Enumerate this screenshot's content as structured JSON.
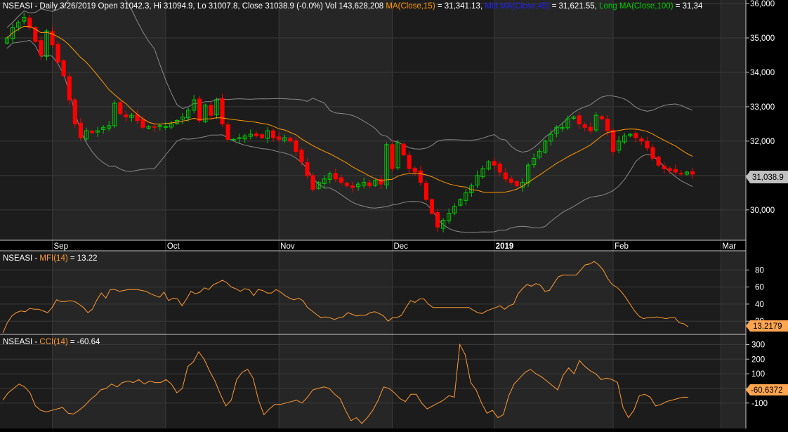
{
  "colors": {
    "background": "#1c1c1c",
    "band_shade": "#262626",
    "grid": "#3a3a3a",
    "separator": "#c8c8c8",
    "axis_text": "#ffffff",
    "candle_up": "#00cc00",
    "candle_down": "#ff0000",
    "ma_short": "#ff9900",
    "ma_mid": "#0000ff",
    "ma_long": "#00cc00",
    "bollinger": "#8a8a8a",
    "indicator_line": "#ff9933",
    "badge_price": "#c0c0c0",
    "badge_indicator": "#ffa54f"
  },
  "price_panel": {
    "header": {
      "symbol": "NSEASI",
      "info": " - Daily 3/26/2019 Open 31042.3, Hi 31094.9, Lo 31007.8, Close 31038.9 (-0.0%) Vol 143,628,208 ",
      "ma_short": "MA(Close,15)",
      "ma_short_value": " = 31,341.13, ",
      "ma_mid": "Mid MA(Close,45)",
      "ma_mid_value": " = 31,621.55, ",
      "ma_long": "Long MA(Close,100)",
      "ma_long_value": " = 31,34"
    },
    "last_value_badge": "31,038.9"
  },
  "mfi_panel": {
    "header": {
      "symbol": "NSEASI",
      "dash": " - ",
      "label": "MFI(14)",
      "value": " = 13.22"
    },
    "last_value_badge": "13.2179"
  },
  "cci_panel": {
    "header": {
      "symbol": "NSEASI",
      "dash": " - ",
      "label": "CCI(14)",
      "value": " = -60.64"
    },
    "last_value_badge": "-60.6372"
  },
  "chart_data": [
    {
      "type": "candlestick",
      "ylim": [
        29200,
        36000
      ],
      "y_ticks": [
        30000,
        31000,
        32000,
        33000,
        34000,
        35000,
        36000
      ],
      "y_tick_labels": [
        "30,000",
        "31,000",
        "32,000",
        "33,000",
        "34,000",
        "35,000",
        "36,000"
      ],
      "x_axis_labels": [
        {
          "label": "Sep",
          "index": 8,
          "bold": false
        },
        {
          "label": "Oct",
          "index": 28,
          "bold": false
        },
        {
          "label": "Nov",
          "index": 48,
          "bold": false
        },
        {
          "label": "Dec",
          "index": 68,
          "bold": false
        },
        {
          "label": "2019",
          "index": 86,
          "bold": true
        },
        {
          "label": "Feb",
          "index": 107,
          "bold": false
        },
        {
          "label": "Mar",
          "index": 126,
          "bold": false
        }
      ],
      "grid": true,
      "close": [
        35000,
        35300,
        35450,
        35600,
        35300,
        34900,
        34500,
        35200,
        34800,
        34300,
        33900,
        33200,
        32500,
        32100,
        32300,
        32250,
        32300,
        32400,
        32450,
        33100,
        32800,
        32700,
        32750,
        32600,
        32400,
        32420,
        32400,
        32450,
        32420,
        32500,
        32600,
        32700,
        32900,
        33200,
        32600,
        33050,
        32750,
        33200,
        32500,
        32050,
        32050,
        32100,
        32150,
        32200,
        32150,
        32100,
        32300,
        32100,
        32050,
        32100,
        32000,
        31700,
        31400,
        31000,
        30600,
        30800,
        30900,
        31050,
        30900,
        30800,
        30700,
        30650,
        30750,
        30800,
        30700,
        30850,
        30750,
        31900,
        31200,
        31950,
        31600,
        31200,
        31100,
        30800,
        30300,
        29900,
        29500,
        29700,
        29900,
        30100,
        30300,
        30500,
        30700,
        31000,
        31200,
        31400,
        31300,
        31100,
        30900,
        30800,
        30700,
        30800,
        31300,
        31500,
        31700,
        32000,
        32200,
        32400,
        32400,
        32650,
        32700,
        32500,
        32400,
        32300,
        32750,
        32650,
        32300,
        31700,
        32000,
        32150,
        32200,
        32100,
        32000,
        31800,
        31500,
        31300,
        31200,
        31150,
        31100,
        31050,
        31100,
        31040
      ],
      "source": "close series; open/high/low reconstructed by script for candles"
    },
    {
      "type": "line",
      "name_printed": "MFI(14)",
      "ylim": [
        7,
        100
      ],
      "y_ticks": [
        20,
        40,
        60,
        80
      ],
      "values": [
        6,
        18,
        26,
        30,
        32,
        31,
        35,
        34,
        34,
        32,
        30,
        36,
        45,
        43,
        43,
        44,
        43,
        40,
        36,
        30,
        34,
        45,
        53,
        47,
        57,
        57,
        55,
        56,
        57,
        57,
        57,
        56,
        55,
        52,
        50,
        48,
        54,
        44,
        47,
        46,
        38,
        46,
        55,
        52,
        54,
        59,
        57,
        63,
        65,
        68,
        65,
        60,
        58,
        55,
        58,
        57,
        50,
        57,
        56,
        53,
        53,
        57,
        54,
        50,
        47,
        45,
        47,
        44,
        36,
        32,
        28,
        24,
        25,
        24,
        22,
        24,
        25,
        30,
        28,
        26,
        27,
        27,
        30,
        31,
        29,
        26,
        20,
        24,
        24,
        27,
        36,
        44,
        42,
        46,
        46,
        40,
        36,
        36,
        36,
        36,
        36,
        36,
        36,
        36,
        36,
        33,
        30,
        29,
        32,
        34,
        36,
        38,
        34,
        38,
        40,
        52,
        58,
        63,
        61,
        64,
        62,
        55,
        56,
        64,
        72,
        74,
        74,
        74,
        74,
        80,
        86,
        87,
        90,
        86,
        80,
        70,
        63,
        60,
        55,
        48,
        40,
        32,
        26,
        23,
        24,
        24,
        25,
        24,
        23,
        24,
        24,
        18,
        17,
        13.22
      ]
    },
    {
      "type": "line",
      "name_printed": "CCI(14)",
      "ylim": [
        -250,
        350
      ],
      "y_ticks": [
        -100,
        0,
        100,
        200,
        300
      ],
      "y_tick_labels": [
        "-100",
        "0",
        "100",
        "200",
        "300"
      ],
      "values": [
        -80,
        -30,
        0,
        30,
        10,
        -30,
        -120,
        -150,
        -160,
        -150,
        -140,
        -130,
        -170,
        -175,
        -150,
        -120,
        -80,
        -50,
        -10,
        0,
        30,
        10,
        40,
        50,
        40,
        60,
        30,
        50,
        40,
        40,
        60,
        30,
        -30,
        0,
        150,
        180,
        250,
        200,
        120,
        50,
        -40,
        -120,
        -80,
        60,
        110,
        130,
        70,
        -80,
        -180,
        -140,
        -110,
        -110,
        -100,
        -90,
        -80,
        -100,
        -60,
        -10,
        0,
        10,
        0,
        -40,
        -70,
        -150,
        -220,
        -200,
        -240,
        -200,
        -150,
        -80,
        10,
        0,
        -30,
        -70,
        -90,
        -40,
        -40,
        -100,
        -140,
        -120,
        -100,
        -80,
        -50,
        -60,
        300,
        230,
        40,
        -10,
        -100,
        -170,
        -150,
        -200,
        -180,
        -50,
        30,
        70,
        110,
        130,
        100,
        80,
        50,
        20,
        -10,
        90,
        140,
        100,
        190,
        150,
        120,
        100,
        60,
        70,
        60,
        40,
        -130,
        -200,
        -150,
        -50,
        -40,
        -60,
        -120,
        -110,
        -90,
        -80,
        -70,
        -60,
        -60.64
      ]
    }
  ]
}
